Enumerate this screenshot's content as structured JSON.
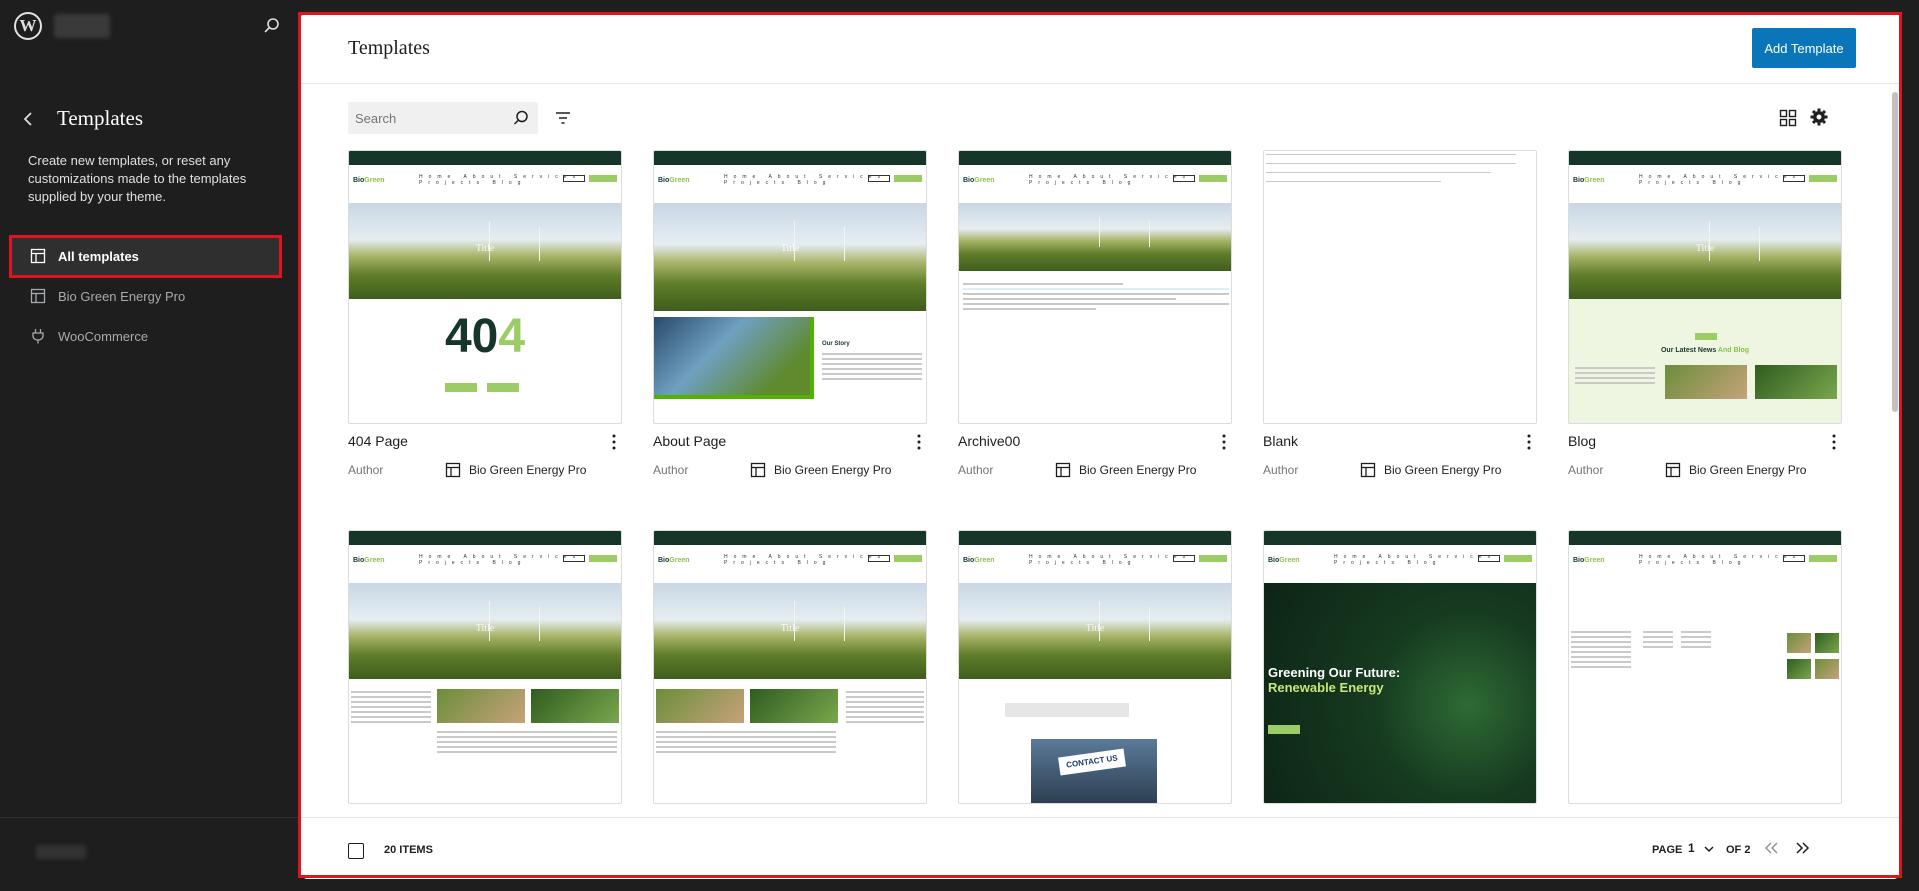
{
  "sidebar": {
    "logo_letter": "W",
    "title": "Templates",
    "description": "Create new templates, or reset any customizations made to the templates supplied by your theme.",
    "items": [
      {
        "label": "All templates"
      },
      {
        "label": "Bio Green Energy Pro"
      },
      {
        "label": "WooCommerce"
      }
    ]
  },
  "header": {
    "title": "Templates",
    "add_button": "Add Template"
  },
  "toolbar": {
    "search_placeholder": "Search"
  },
  "templates": [
    {
      "title": "404 Page",
      "author_label": "Author",
      "source": "Bio Green Energy Pro"
    },
    {
      "title": "About Page",
      "author_label": "Author",
      "source": "Bio Green Energy Pro"
    },
    {
      "title": "Archive00",
      "author_label": "Author",
      "source": "Bio Green Energy Pro"
    },
    {
      "title": "Blank",
      "author_label": "Author",
      "source": "Bio Green Energy Pro"
    },
    {
      "title": "Blog",
      "author_label": "Author",
      "source": "Bio Green Energy Pro"
    }
  ],
  "previews": {
    "logo_bio": "Bio",
    "logo_green": "Green",
    "hero_title": "Title",
    "four": "40",
    "four_last": "4",
    "story": "Our Story",
    "blog_head": "Our Latest News",
    "blog_head_accent": "And Blog",
    "dark_title_1": "Greening Our Future:",
    "dark_title_2": "Renewable Energy",
    "contact_sign": "CONTACT US"
  },
  "pagination": {
    "items": "20 ITEMS",
    "page_label": "PAGE",
    "page_value": "1",
    "of_label": "OF 2"
  },
  "colors": {
    "accent": "#0a75b8",
    "highlight": "#e0141e",
    "brand_dark": "#17362a",
    "brand_green": "#9ccc65"
  }
}
